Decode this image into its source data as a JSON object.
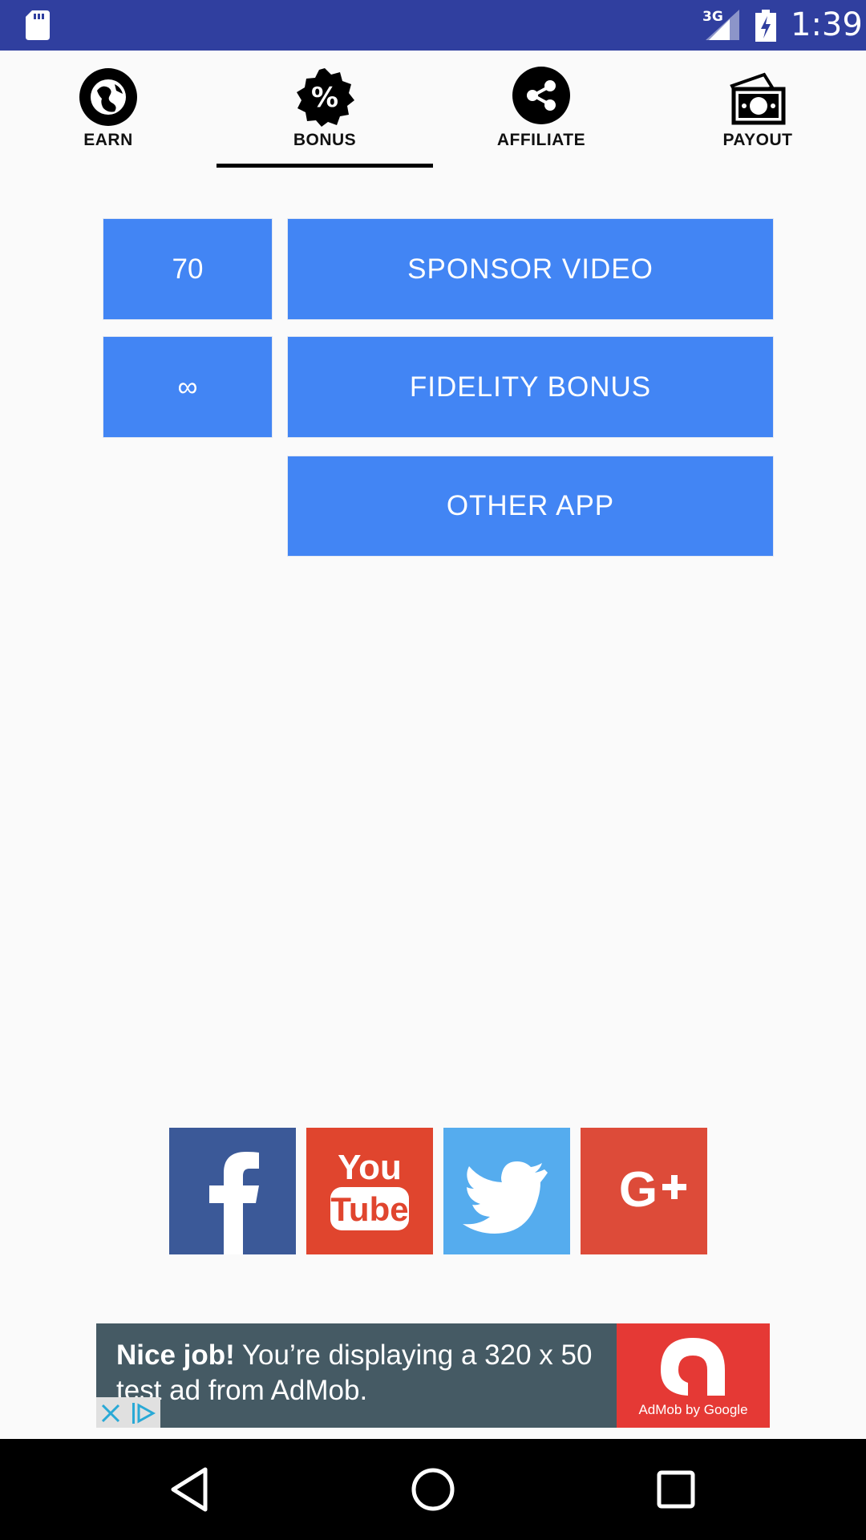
{
  "status_bar": {
    "network": "3G",
    "time": "1:39",
    "icons": [
      "sd-card-icon",
      "signal-icon",
      "battery-icon"
    ]
  },
  "tabs": [
    {
      "label": "EARN",
      "icon": "globe-icon"
    },
    {
      "label": "BONUS",
      "icon": "percent-badge-icon",
      "selected": true
    },
    {
      "label": "AFFILIATE",
      "icon": "share-icon"
    },
    {
      "label": "PAYOUT",
      "icon": "cash-icon"
    }
  ],
  "bonus": {
    "sponsor_count": "70",
    "fidelity_count": "∞",
    "sponsor_video_label": "SPONSOR VIDEO",
    "fidelity_bonus_label": "FIDELITY BONUS",
    "other_app_label": "OTHER APP"
  },
  "social": [
    {
      "name": "Facebook",
      "icon": "facebook-icon",
      "color": "#3b5998"
    },
    {
      "name": "YouTube",
      "icon": "youtube-icon",
      "color": "#e0452e"
    },
    {
      "name": "Twitter",
      "icon": "twitter-icon",
      "color": "#55acee"
    },
    {
      "name": "Google+",
      "icon": "google-plus-icon",
      "color": "#dd4b39"
    }
  ],
  "ad": {
    "headline": "Nice job!",
    "text": " You’re displaying a 320 x 50 test ad from AdMob.",
    "logo_label": "AdMob by Google"
  },
  "colors": {
    "status_bar": "#303f9f",
    "button": "#4285f4",
    "background": "#fafafa"
  }
}
